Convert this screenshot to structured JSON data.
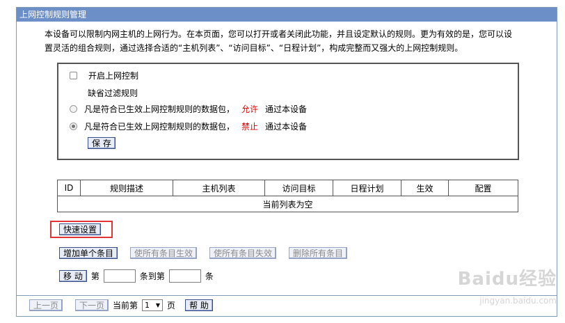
{
  "title": "上网控制规则管理",
  "description": {
    "line1": "本设备可以限制内网主机的上网行为。在本页面，您可以打开或者关闭此功能，并且设定默认的规则。更为有效的是，您可以设",
    "line2": "置灵活的组合规则，通过选择合适的“主机列表”、“访问目标”、“日程计划”，构成完整而又强大的上网控制规则。"
  },
  "control": {
    "enable_label": "开启上网控制",
    "enabled": false,
    "default_rule_label": "缺省过滤规则",
    "option_allow": {
      "prefix": "凡是符合已生效上网控制规则的数据包，",
      "action": "允许",
      "suffix": "通过本设备",
      "selected": false
    },
    "option_deny": {
      "prefix": "凡是符合已生效上网控制规则的数据包，",
      "action": "禁止",
      "suffix": "通过本设备",
      "selected": true
    },
    "save_label": "保 存"
  },
  "table": {
    "headers": [
      "ID",
      "规则描述",
      "主机列表",
      "访问目标",
      "日程计划",
      "生效",
      "配置"
    ],
    "empty_text": "当前列表为空"
  },
  "actions": {
    "quick_setup": "快速设置",
    "add_entry": "增加单个条目",
    "enable_all": "使所有条目生效",
    "disable_all": "使所有条目失效",
    "delete_all": "删除所有条目"
  },
  "move": {
    "button": "移 动",
    "from_label": "第",
    "to_label": "条到第",
    "end_label": "条"
  },
  "pager": {
    "prev": "上一页",
    "next": "下一页",
    "current_label": "当前第",
    "page_value": "1",
    "page_suffix": "页",
    "help": "帮 助"
  },
  "watermark": {
    "brand": "Baidu经验",
    "url": "jingyan.baidu.com"
  }
}
